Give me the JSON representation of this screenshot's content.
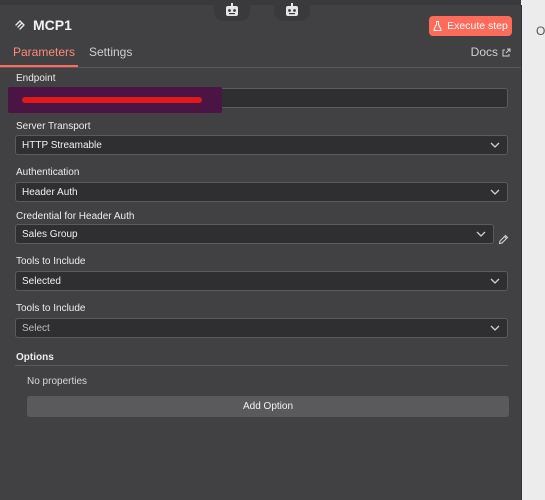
{
  "node": {
    "title": "MCP1",
    "execute_label": "Execute step"
  },
  "tabs": {
    "parameters": "Parameters",
    "settings": "Settings",
    "docs": "Docs"
  },
  "fields": {
    "endpoint": {
      "label": "Endpoint",
      "value": ""
    },
    "server_transport": {
      "label": "Server Transport",
      "value": "HTTP Streamable"
    },
    "authentication": {
      "label": "Authentication",
      "value": "Header Auth"
    },
    "credential": {
      "label": "Credential for Header Auth",
      "value": "Sales Group"
    },
    "tools_include_1": {
      "label": "Tools to Include",
      "value": "Selected"
    },
    "tools_include_2": {
      "label": "Tools to Include",
      "placeholder": "Select"
    }
  },
  "options": {
    "label": "Options",
    "empty_text": "No properties",
    "add_label": "Add Option"
  },
  "side": {
    "letter": "O"
  },
  "colors": {
    "accent": "#ff6b5a",
    "panel": "#414144",
    "field_bg": "#2f2f31"
  },
  "icons": [
    "robot-icon",
    "mcp-icon",
    "flask-icon",
    "external-link-icon",
    "chevron-down-icon",
    "pencil-icon"
  ]
}
